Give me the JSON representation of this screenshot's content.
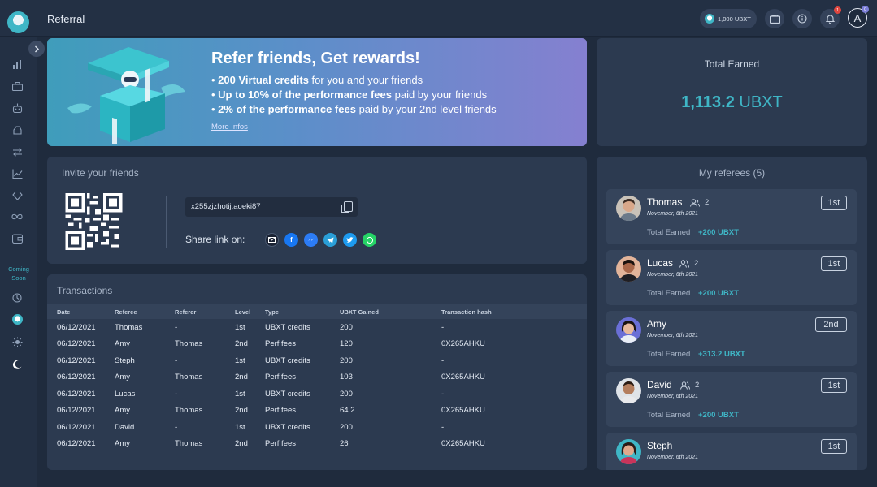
{
  "header": {
    "title": "Referral",
    "balance": "1,000 UBXT",
    "notification_count": "1",
    "avatar_letter": "A",
    "avatar_badge": "0"
  },
  "sidebar": {
    "coming_soon": "Coming Soon"
  },
  "banner": {
    "title": "Refer friends, Get rewards!",
    "items": [
      {
        "bold": "200 Virtual credits",
        "rest": " for you and your friends"
      },
      {
        "bold": "Up to 10% of the performance fees",
        "rest": " paid by your friends"
      },
      {
        "bold": "2% of the performance fees",
        "rest": " paid by your 2nd level friends"
      }
    ],
    "more_infos": "More Infos"
  },
  "total": {
    "title": "Total Earned",
    "amount": "1,113.2",
    "unit": " UBXT"
  },
  "invite": {
    "title": "Invite your friends",
    "code": "x255zjzhotij,aoeki87",
    "share_label": "Share link on:"
  },
  "transactions": {
    "title": "Transactions",
    "columns": [
      "Date",
      "Referee",
      "Referer",
      "Level",
      "Type",
      "UBXT Gained",
      "Transaction hash"
    ],
    "rows": [
      [
        "06/12/2021",
        "Thomas",
        "-",
        "1st",
        "UBXT credits",
        "200",
        "-"
      ],
      [
        "06/12/2021",
        "Amy",
        "Thomas",
        "2nd",
        "Perf fees",
        "120",
        "0X265AHKU"
      ],
      [
        "06/12/2021",
        "Steph",
        "-",
        "1st",
        "UBXT credits",
        "200",
        "-"
      ],
      [
        "06/12/2021",
        "Amy",
        "Thomas",
        "2nd",
        "Perf fees",
        "103",
        "0X265AHKU"
      ],
      [
        "06/12/2021",
        "Lucas",
        "-",
        "1st",
        "UBXT credits",
        "200",
        "-"
      ],
      [
        "06/12/2021",
        "Amy",
        "Thomas",
        "2nd",
        "Perf fees",
        "64.2",
        "0X265AHKU"
      ],
      [
        "06/12/2021",
        "David",
        "-",
        "1st",
        "UBXT credits",
        "200",
        "-"
      ],
      [
        "06/12/2021",
        "Amy",
        "Thomas",
        "2nd",
        "Perf fees",
        "26",
        "0X265AHKU"
      ]
    ]
  },
  "referees": {
    "title": "My referees (5)",
    "earned_label": "Total Earned",
    "items": [
      {
        "name": "Thomas",
        "friends": "2",
        "date": "November, 6th 2021",
        "level": "1st",
        "earned": "+200 UBXT"
      },
      {
        "name": "Lucas",
        "friends": "2",
        "date": "November, 6th 2021",
        "level": "1st",
        "earned": "+200 UBXT"
      },
      {
        "name": "Amy",
        "friends": "",
        "date": "November, 6th 2021",
        "level": "2nd",
        "earned": "+313.2 UBXT"
      },
      {
        "name": "David",
        "friends": "2",
        "date": "November, 6th 2021",
        "level": "1st",
        "earned": "+200 UBXT"
      },
      {
        "name": "Steph",
        "friends": "",
        "date": "November, 6th 2021",
        "level": "1st",
        "earned": ""
      }
    ]
  },
  "colors": {
    "accent": "#3fb6c6",
    "background": "#1f2b3d",
    "card": "#2c3a50"
  }
}
